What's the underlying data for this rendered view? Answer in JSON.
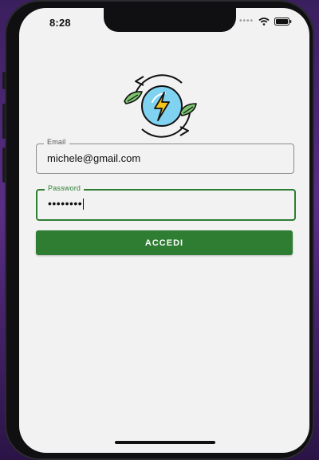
{
  "status_bar": {
    "time": "8:28",
    "icons": [
      "dots-icon",
      "wifi-icon",
      "battery-icon"
    ]
  },
  "logo": {
    "icon": "renewable-energy-logo",
    "colors": {
      "lightning": "#f5c518",
      "circle": "#7fd3f0",
      "leaf": "#7cc46e"
    }
  },
  "email": {
    "label": "Email",
    "value": "michele@gmail.com"
  },
  "password": {
    "label": "Password",
    "masked_value": "••••••••"
  },
  "login_button": {
    "label": "ACCEDI",
    "color": "#2e7d32"
  }
}
